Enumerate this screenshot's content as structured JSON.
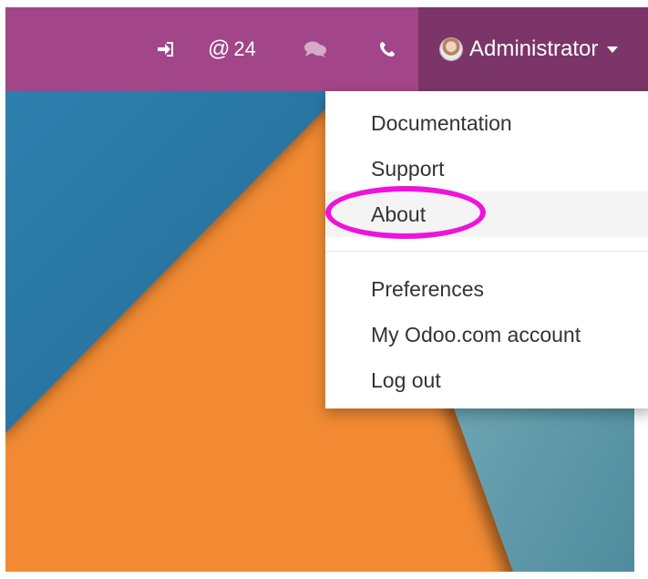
{
  "navbar": {
    "icons": [
      "sign-in-icon",
      "at-icon",
      "chat-icon",
      "phone-icon"
    ],
    "mentions_count": "24",
    "at_symbol": "@",
    "user": {
      "name": "Administrator"
    }
  },
  "user_menu": {
    "items": [
      {
        "label": "Documentation"
      },
      {
        "label": "Support"
      },
      {
        "label": "About"
      },
      {
        "label": "Preferences"
      },
      {
        "label": "My Odoo.com account"
      },
      {
        "label": "Log out"
      }
    ],
    "highlighted_item": "About"
  },
  "colors": {
    "navbar": "#a24689",
    "user_menu_bg": "#7c3568",
    "blue": "#2e78a6",
    "orange": "#f18a33",
    "teal": "#5c98a8",
    "highlight": "#ee12dd"
  }
}
